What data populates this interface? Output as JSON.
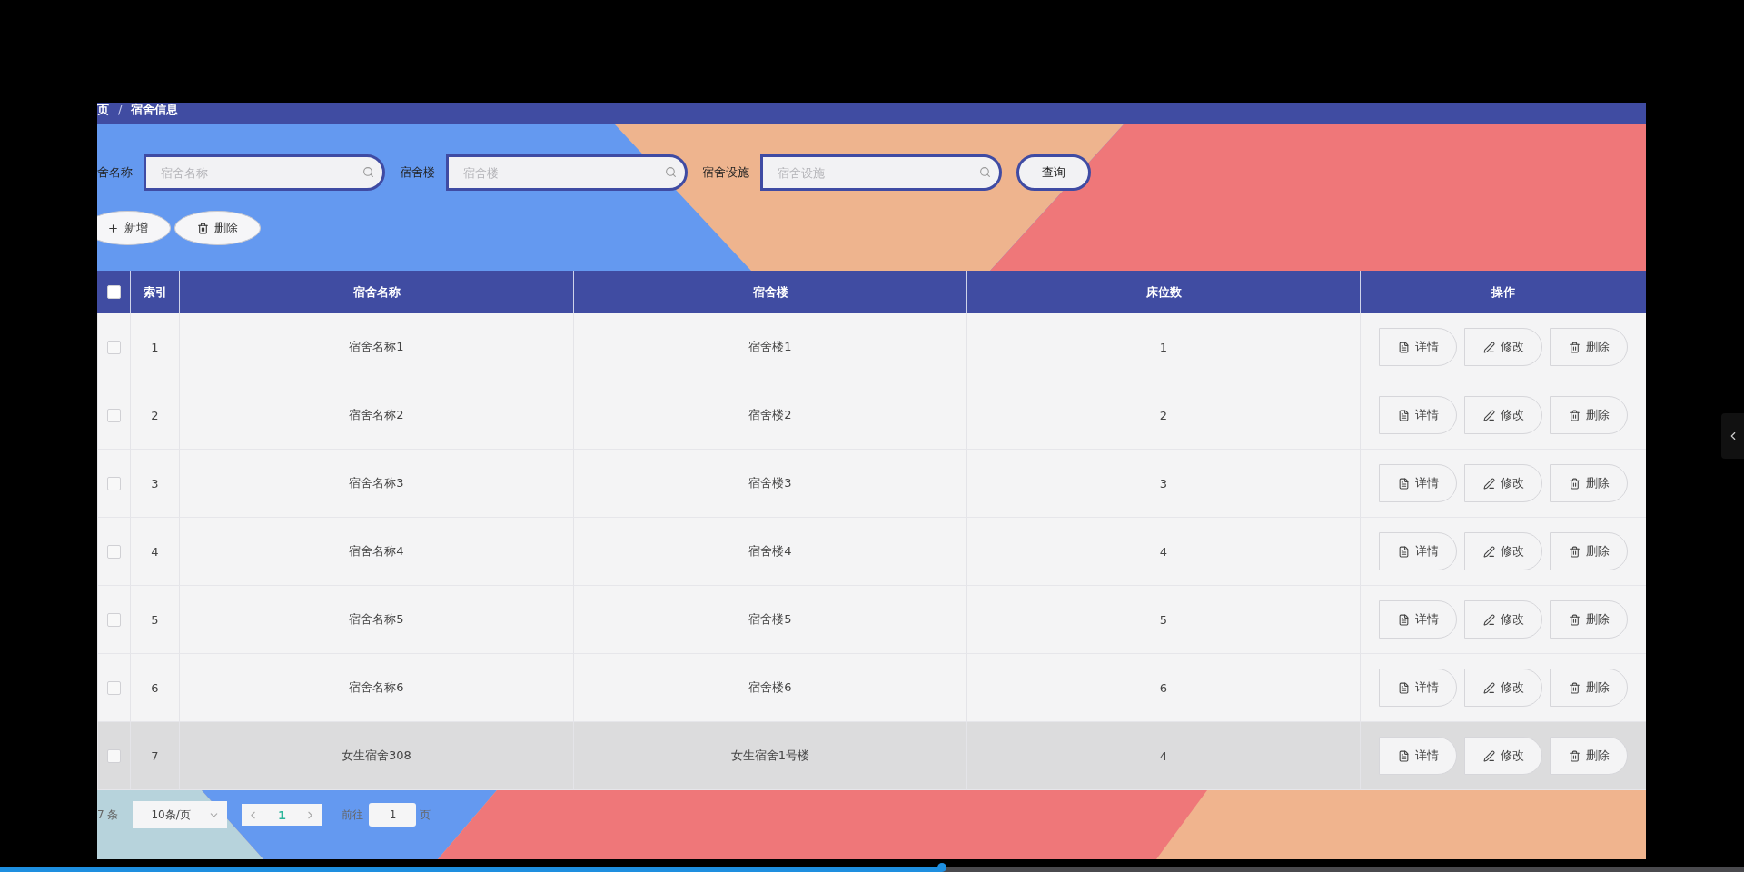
{
  "breadcrumb": [
    {
      "kind": "item",
      "text": "页"
    },
    {
      "kind": "separator",
      "text": "/"
    },
    {
      "kind": "item",
      "text": "宿舍信息"
    }
  ],
  "search": {
    "fields": [
      {
        "label": "舍名称",
        "placeholder": "宿舍名称"
      },
      {
        "label": "宿舍楼",
        "placeholder": "宿舍楼"
      },
      {
        "label": "宿舍设施",
        "placeholder": "宿舍设施"
      }
    ],
    "button": "查询"
  },
  "toolbar": [
    {
      "kind": "add",
      "label": "新增"
    },
    {
      "kind": "delete",
      "label": "删除"
    }
  ],
  "table": {
    "all_checked": false,
    "columns": [
      "索引",
      "宿舍名称",
      "宿舍楼",
      "床位数",
      "操作"
    ],
    "rows": [
      {
        "checked": false,
        "highlighted": false,
        "cells": [
          "1",
          "宿舍名称1",
          "宿舍楼1",
          "1"
        ],
        "actions": [
          {
            "kind": "detail",
            "label": "详情"
          },
          {
            "kind": "edit",
            "label": "修改"
          },
          {
            "kind": "delete",
            "label": "删除"
          }
        ]
      },
      {
        "checked": false,
        "highlighted": false,
        "cells": [
          "2",
          "宿舍名称2",
          "宿舍楼2",
          "2"
        ],
        "actions": [
          {
            "kind": "detail",
            "label": "详情"
          },
          {
            "kind": "edit",
            "label": "修改"
          },
          {
            "kind": "delete",
            "label": "删除"
          }
        ]
      },
      {
        "checked": false,
        "highlighted": false,
        "cells": [
          "3",
          "宿舍名称3",
          "宿舍楼3",
          "3"
        ],
        "actions": [
          {
            "kind": "detail",
            "label": "详情"
          },
          {
            "kind": "edit",
            "label": "修改"
          },
          {
            "kind": "delete",
            "label": "删除"
          }
        ]
      },
      {
        "checked": false,
        "highlighted": false,
        "cells": [
          "4",
          "宿舍名称4",
          "宿舍楼4",
          "4"
        ],
        "actions": [
          {
            "kind": "detail",
            "label": "详情"
          },
          {
            "kind": "edit",
            "label": "修改"
          },
          {
            "kind": "delete",
            "label": "删除"
          }
        ]
      },
      {
        "checked": false,
        "highlighted": false,
        "cells": [
          "5",
          "宿舍名称5",
          "宿舍楼5",
          "5"
        ],
        "actions": [
          {
            "kind": "detail",
            "label": "详情"
          },
          {
            "kind": "edit",
            "label": "修改"
          },
          {
            "kind": "delete",
            "label": "删除"
          }
        ]
      },
      {
        "checked": false,
        "highlighted": false,
        "cells": [
          "6",
          "宿舍名称6",
          "宿舍楼6",
          "6"
        ],
        "actions": [
          {
            "kind": "detail",
            "label": "详情"
          },
          {
            "kind": "edit",
            "label": "修改"
          },
          {
            "kind": "delete",
            "label": "删除"
          }
        ]
      },
      {
        "checked": false,
        "highlighted": true,
        "cells": [
          "7",
          "女生宿舍308",
          "女生宿舍1号楼",
          "4"
        ],
        "actions": [
          {
            "kind": "detail",
            "label": "详情"
          },
          {
            "kind": "edit",
            "label": "修改"
          },
          {
            "kind": "delete",
            "label": "删除"
          }
        ]
      }
    ]
  },
  "pagination": {
    "total": "7 条",
    "page_size": "10条/页",
    "current_page": "1",
    "goto_label": "前往",
    "goto_value": "1",
    "page_unit": "页"
  },
  "player": {
    "level": 0.54
  }
}
